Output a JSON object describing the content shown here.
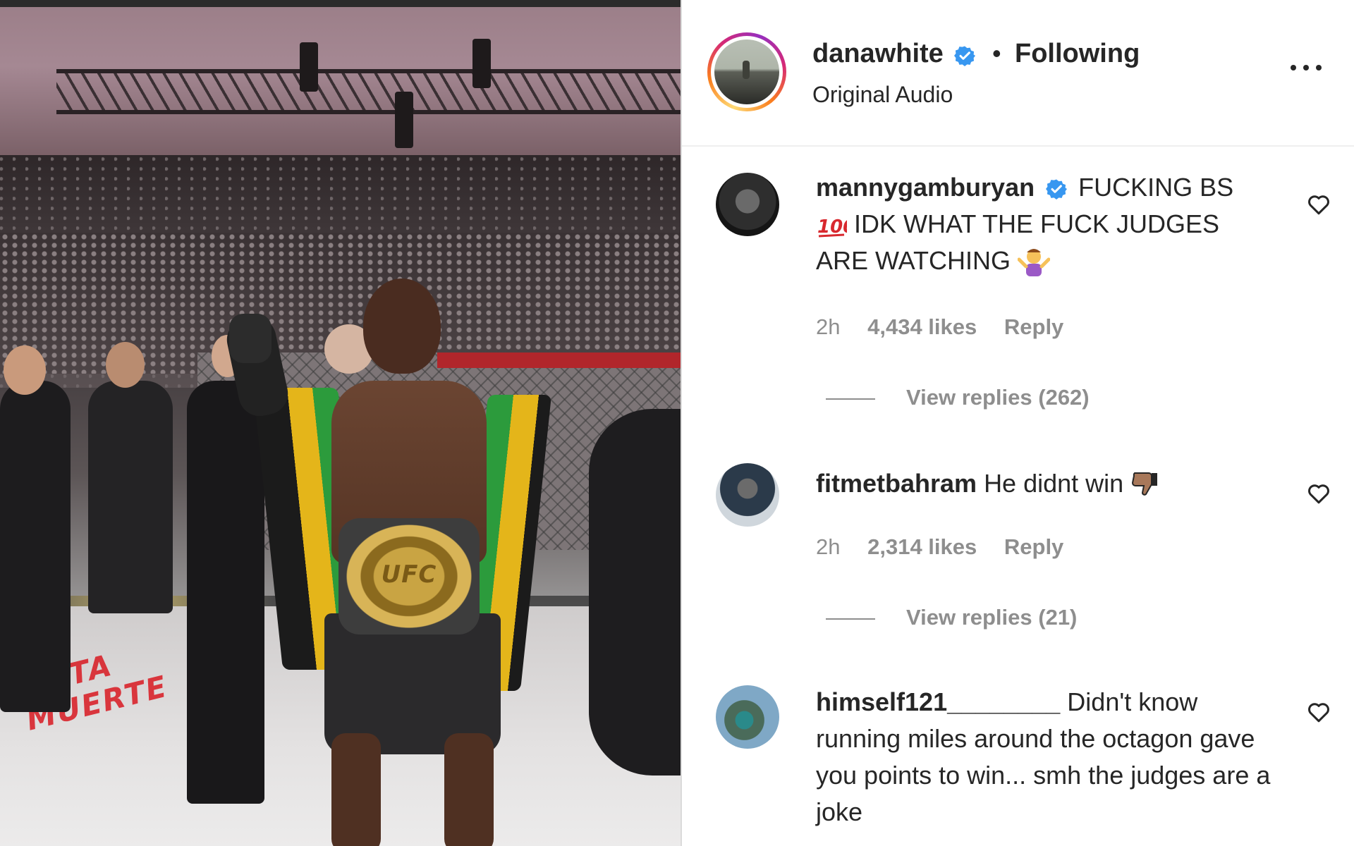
{
  "post": {
    "username": "danawhite",
    "follow_status": "Following",
    "separator": "•",
    "audio": "Original Audio"
  },
  "media": {
    "belt_text": "UFC",
    "floor_text_1": "SANTA",
    "floor_text_2": "MUERTE"
  },
  "comments": [
    {
      "username": "mannygamburyan",
      "verified": true,
      "text_1": "FUCKING BS",
      "text_2": "IDK WHAT THE FUCK JUDGES ARE WATCHING",
      "time": "2h",
      "likes": "4,434 likes",
      "reply": "Reply",
      "view_replies": "View replies (262)"
    },
    {
      "username": "fitmetbahram",
      "verified": false,
      "text_1": "He didnt win",
      "time": "2h",
      "likes": "2,314 likes",
      "reply": "Reply",
      "view_replies": "View replies (21)"
    },
    {
      "username": "himself121________",
      "verified": false,
      "text_1": "Didn't know running miles around the octagon gave you points to win... smh the judges are a joke"
    }
  ],
  "icons": {
    "verified": "verified-badge-icon",
    "more": "more-options-icon",
    "like": "heart-outline-icon",
    "hundred": "hundred-points-emoji",
    "shrug": "person-shrugging-emoji",
    "thumbs_down": "thumbs-down-emoji"
  },
  "colors": {
    "verified_blue": "#3897f0",
    "text": "#262626",
    "muted": "#8e8e8e"
  }
}
